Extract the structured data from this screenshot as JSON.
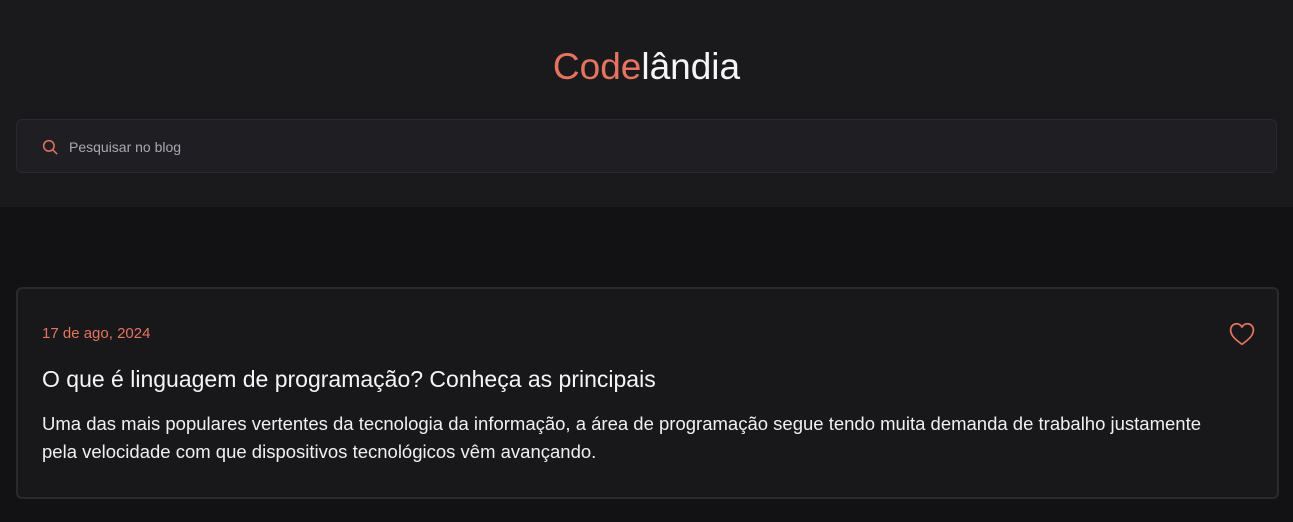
{
  "header": {
    "logo_accent": "Code",
    "logo_rest": "lândia"
  },
  "search": {
    "placeholder": "Pesquisar no blog",
    "value": ""
  },
  "post": {
    "date": "17 de ago, 2024",
    "title": "O que é linguagem de programação? Conheça as principais",
    "excerpt": "Uma das mais populares vertentes da tecnologia da informação, a área de programação segue tendo muita demanda de trabalho justamente pela velocidade com que dispositivos tecnológicos vêm avançando."
  },
  "icons": {
    "search": "search-icon",
    "favorite": "heart-icon"
  },
  "colors": {
    "accent": "#e5735f",
    "background": "#121214",
    "header_background": "#1a1a1d",
    "text": "#f5f5f5"
  }
}
